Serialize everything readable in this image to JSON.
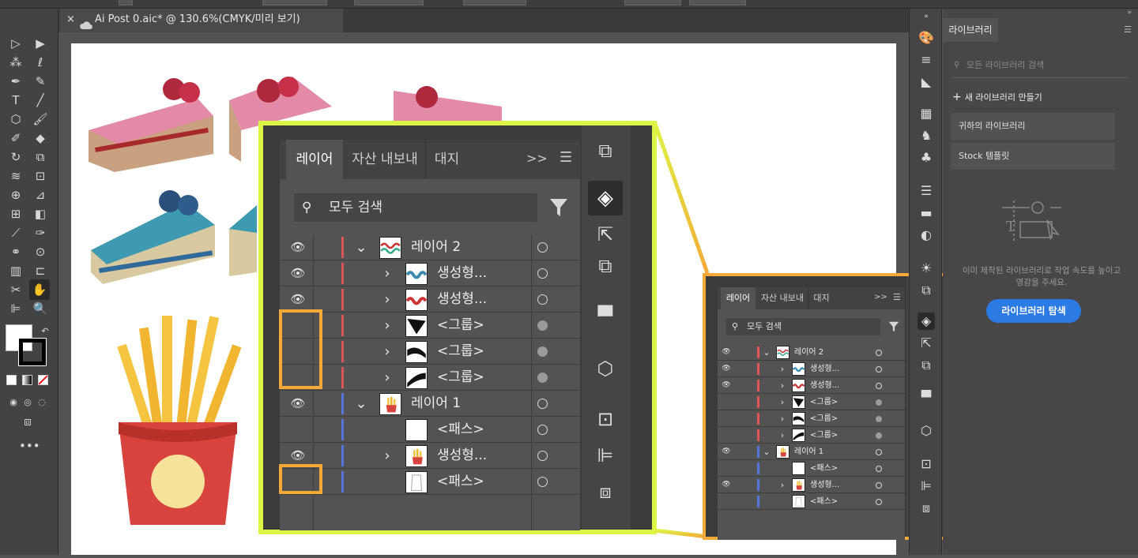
{
  "document_tab": {
    "title": "Ai Post 0.aic* @ 130.6%(CMYK/미리 보기)",
    "close": "×"
  },
  "library": {
    "tab": "라이브러리",
    "search_placeholder": "모든 라이브러리 검색",
    "new_library": "새 라이브러리 만들기",
    "items": [
      "귀하의 라이브러리",
      "Stock 템플릿"
    ],
    "message": "이미 제작된 라이브러리로 작업 속도를 높이고 영감을 주세요.",
    "explore_button": "라이브러리 탐색"
  },
  "layers_panel": {
    "tabs": [
      "레이어",
      "자산 내보내",
      "대지"
    ],
    "more": ">>",
    "search_placeholder": "모두 검색",
    "rows": [
      {
        "label": "레이어 2",
        "eye": true,
        "color": "#e05555",
        "indent": 0,
        "expand": "v",
        "target": "open",
        "thumb": "waves"
      },
      {
        "label": "생성형...",
        "eye": true,
        "color": "#e05555",
        "indent": 1,
        "expand": ">",
        "target": "open",
        "thumb": "waves-blue"
      },
      {
        "label": "생성형...",
        "eye": true,
        "color": "#e05555",
        "indent": 1,
        "expand": ">",
        "target": "open",
        "thumb": "waves-red"
      },
      {
        "label": "<그룹>",
        "eye": false,
        "color": "#e05555",
        "indent": 1,
        "expand": ">",
        "target": "filled",
        "thumb": "shape1"
      },
      {
        "label": "<그룹>",
        "eye": false,
        "color": "#e05555",
        "indent": 1,
        "expand": ">",
        "target": "filled",
        "thumb": "shape2"
      },
      {
        "label": "<그룹>",
        "eye": false,
        "color": "#e05555",
        "indent": 1,
        "expand": ">",
        "target": "filled",
        "thumb": "shape3"
      },
      {
        "label": "레이어 1",
        "eye": true,
        "color": "#5577dd",
        "indent": 0,
        "expand": "v",
        "target": "open",
        "thumb": "fries"
      },
      {
        "label": "<패스>",
        "eye": false,
        "color": "#5577dd",
        "indent": 1,
        "expand": "",
        "target": "open",
        "thumb": "blank"
      },
      {
        "label": "생성형...",
        "eye": true,
        "color": "#5577dd",
        "indent": 1,
        "expand": ">",
        "target": "open",
        "thumb": "fries"
      },
      {
        "label": "<패스>",
        "eye": false,
        "color": "#5577dd",
        "indent": 1,
        "expand": "",
        "target": "open",
        "thumb": "outline"
      }
    ]
  },
  "colors": {
    "zoom_border": "#ddf545",
    "highlight": "#f4a938",
    "accent": "#2c7be5"
  }
}
